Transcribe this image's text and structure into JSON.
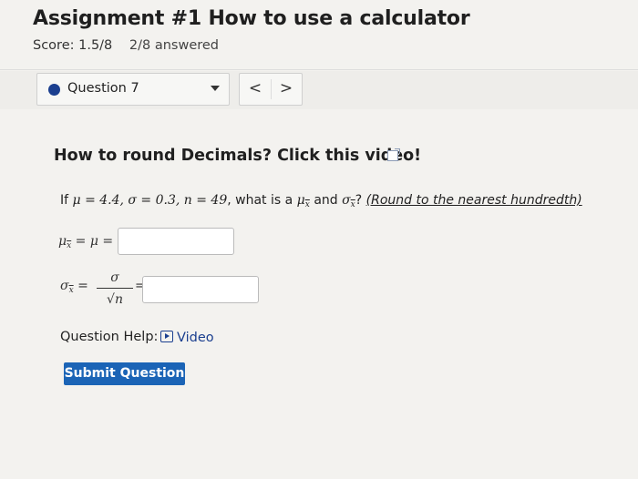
{
  "header": {
    "title": "Assignment #1 How to use a calculator",
    "score": "Score: 1.5/8",
    "answered": "2/8 answered"
  },
  "question_nav": {
    "selected_question": "Question 7",
    "prev_label": "<",
    "next_label": ">"
  },
  "question": {
    "title": "How to round Decimals? Click this video!",
    "problem_prefix": "If",
    "mu_value": "μ = 4.4,",
    "sigma_value": "σ = 0.3,",
    "n_value": "n = 49",
    "what_is": ", what is a",
    "and_text": "and",
    "qmark": "?",
    "round_note": "(Round to the nearest hundredth)",
    "eq1_text": "= μ =",
    "eq2_num": "σ",
    "eq2_den": "√n",
    "eq_sign": "="
  },
  "help": {
    "label": "Question Help:",
    "video_label": "Video"
  },
  "submit_label": "Submit Question",
  "colors": {
    "accent": "#1b64b6",
    "dot": "#1b3f8f",
    "background": "#f3f2ef"
  }
}
